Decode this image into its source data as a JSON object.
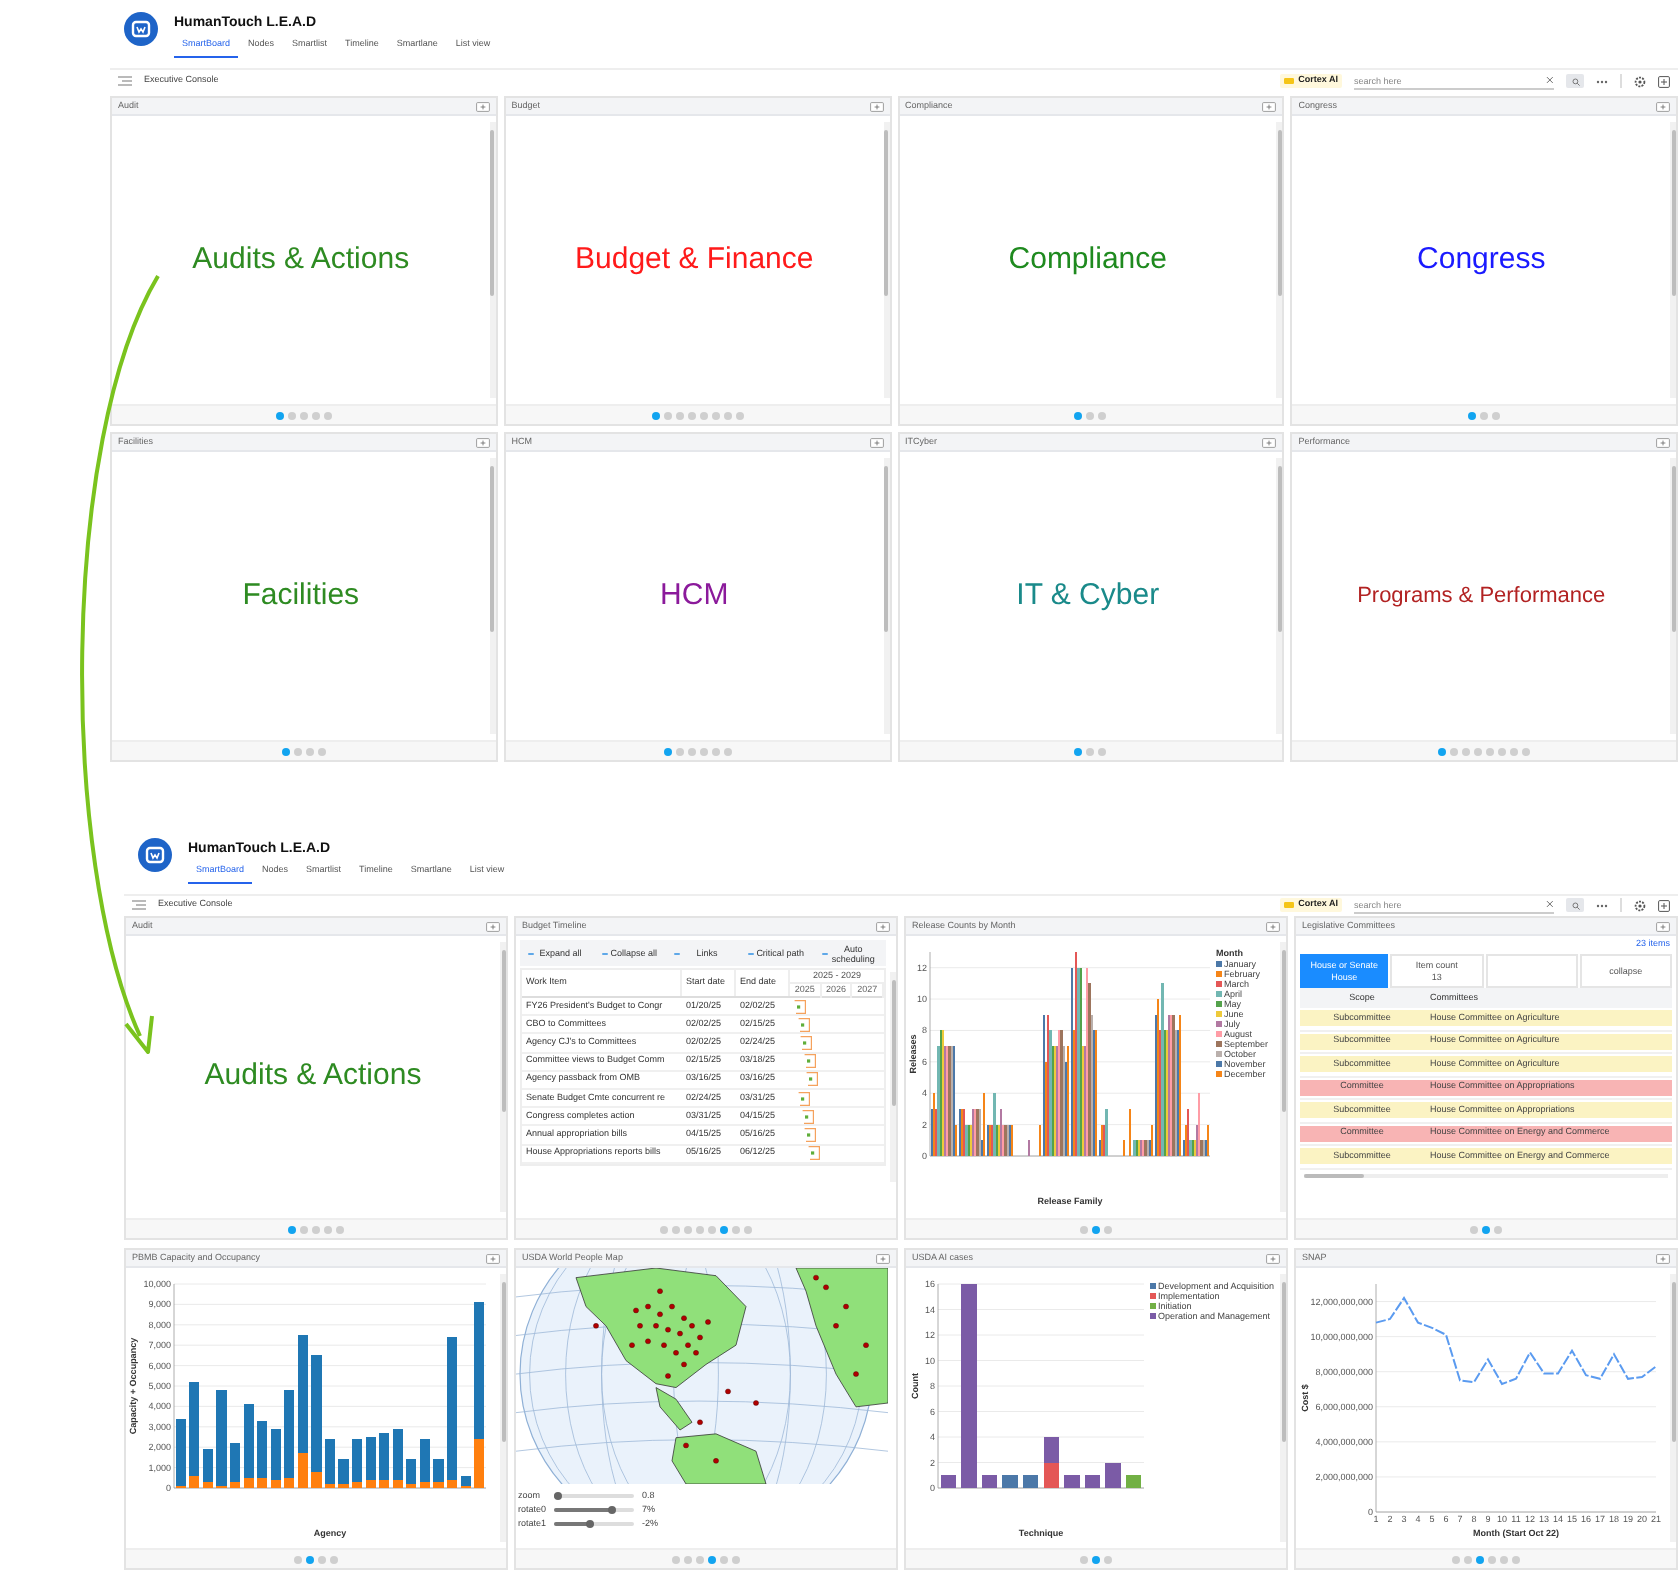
{
  "screens": [
    {
      "app_title": "HumanTouch L.E.A.D",
      "tabs": [
        {
          "label": "SmartBoard",
          "selected": true
        },
        {
          "label": "Nodes",
          "selected": false
        },
        {
          "label": "Smartlist",
          "selected": false
        },
        {
          "label": "Timeline",
          "selected": false
        },
        {
          "label": "Smartlane",
          "selected": false
        },
        {
          "label": "List view",
          "selected": false
        }
      ],
      "breadcrumb": "Executive Console",
      "ai_label": "Cortex AI",
      "search": {
        "placeholder": "search here"
      },
      "panels": [
        {
          "title": "Audit",
          "kind": "text",
          "heading": "Audits & Actions",
          "color": "#2e8b22",
          "pages": [
            {
              "selected": true
            },
            {
              "selected": false
            },
            {
              "selected": false
            },
            {
              "selected": false
            },
            {
              "selected": false
            }
          ]
        },
        {
          "title": "Budget",
          "kind": "text",
          "heading": "Budget & Finance",
          "color": "#ff1a1a",
          "pages": [
            {
              "selected": true
            },
            {
              "selected": false
            },
            {
              "selected": false
            },
            {
              "selected": false
            },
            {
              "selected": false
            },
            {
              "selected": false
            },
            {
              "selected": false
            },
            {
              "selected": false
            }
          ]
        },
        {
          "title": "Compliance",
          "kind": "text",
          "heading": "Compliance",
          "color": "#1f8a1f",
          "pages": [
            {
              "selected": true
            },
            {
              "selected": false
            },
            {
              "selected": false
            }
          ]
        },
        {
          "title": "Congress",
          "kind": "text",
          "heading": "Congress",
          "color": "#1a1aff",
          "pages": [
            {
              "selected": true
            },
            {
              "selected": false
            },
            {
              "selected": false
            }
          ]
        },
        {
          "title": "Facilities",
          "kind": "text",
          "heading": "Facilities",
          "color": "#2e8b22",
          "pages": [
            {
              "selected": true
            },
            {
              "selected": false
            },
            {
              "selected": false
            },
            {
              "selected": false
            }
          ]
        },
        {
          "title": "HCM",
          "kind": "text",
          "heading": "HCM",
          "color": "#8b1a9b",
          "pages": [
            {
              "selected": true
            },
            {
              "selected": false
            },
            {
              "selected": false
            },
            {
              "selected": false
            },
            {
              "selected": false
            },
            {
              "selected": false
            }
          ]
        },
        {
          "title": "ITCyber",
          "kind": "text",
          "heading": "IT & Cyber",
          "color": "#1a8a8a",
          "pages": [
            {
              "selected": true
            },
            {
              "selected": false
            },
            {
              "selected": false
            }
          ]
        },
        {
          "title": "Performance",
          "kind": "text",
          "heading": "Programs & Performance",
          "color": "#b22222",
          "pages": [
            {
              "selected": true
            },
            {
              "selected": false
            },
            {
              "selected": false
            },
            {
              "selected": false
            },
            {
              "selected": false
            },
            {
              "selected": false
            },
            {
              "selected": false
            },
            {
              "selected": false
            }
          ]
        }
      ]
    },
    {
      "app_title": "HumanTouch L.E.A.D",
      "tabs": [
        {
          "label": "SmartBoard",
          "selected": true
        },
        {
          "label": "Nodes",
          "selected": false
        },
        {
          "label": "Smartlist",
          "selected": false
        },
        {
          "label": "Timeline",
          "selected": false
        },
        {
          "label": "Smartlane",
          "selected": false
        },
        {
          "label": "List view",
          "selected": false
        }
      ],
      "breadcrumb": "Executive Console",
      "ai_label": "Cortex AI",
      "search": {
        "placeholder": "search here"
      },
      "panels": [
        {
          "title": "Audit",
          "kind": "text",
          "heading": "Audits & Actions",
          "color": "#2e8b22",
          "pages": [
            {
              "selected": true
            },
            {
              "selected": false
            },
            {
              "selected": false
            },
            {
              "selected": false
            },
            {
              "selected": false
            }
          ]
        },
        {
          "title": "Budget Timeline",
          "kind": "timeline",
          "toolbar": [
            "Expand all",
            "Collapse all",
            "Links",
            "Critical path",
            "Auto scheduling"
          ],
          "columns": [
            "Work Item",
            "Start date",
            "End date"
          ],
          "range": "2025 - 2029",
          "years": [
            "2025",
            "2026",
            "2027"
          ],
          "rows": [
            {
              "work_item": "FY26 President's Budget to Congr",
              "start": "01/20/25",
              "end": "02/02/25"
            },
            {
              "work_item": "CBO to Committees",
              "start": "02/02/25",
              "end": "02/15/25"
            },
            {
              "work_item": "Agency CJ's to Committees",
              "start": "02/02/25",
              "end": "02/24/25"
            },
            {
              "work_item": "Committee views to Budget Comm",
              "start": "02/15/25",
              "end": "03/18/25"
            },
            {
              "work_item": "Agency passback from OMB",
              "start": "03/16/25",
              "end": "03/16/25"
            },
            {
              "work_item": "Senate Budget Cmte concurrent re",
              "start": "02/24/25",
              "end": "03/31/25"
            },
            {
              "work_item": "Congress completes action",
              "start": "03/31/25",
              "end": "04/15/25"
            },
            {
              "work_item": "Annual appropriation bills",
              "start": "04/15/25",
              "end": "05/16/25"
            },
            {
              "work_item": "House Appropriations reports bills",
              "start": "05/16/25",
              "end": "06/12/25"
            }
          ],
          "pages": [
            {
              "selected": false
            },
            {
              "selected": false
            },
            {
              "selected": false
            },
            {
              "selected": false
            },
            {
              "selected": false
            },
            {
              "selected": true
            },
            {
              "selected": false
            },
            {
              "selected": false
            }
          ]
        },
        {
          "title": "Release Counts by Month",
          "kind": "chart",
          "legend_title": "Month",
          "chart_data": {
            "type": "bar",
            "grid": true,
            "legend": "right",
            "ylabel": "Releases",
            "xlabel": "Release Family",
            "yticks": [
              0,
              2,
              4,
              6,
              8,
              10,
              12
            ],
            "ylim": [
              0,
              13
            ],
            "series": [
              {
                "name": "January",
                "color": "#4c78a8",
                "values": [
                  3,
                  3,
                  2,
                  0,
                  9,
                  12,
                  1,
                  0,
                  9,
                  1
                ]
              },
              {
                "name": "February",
                "color": "#f58518",
                "values": [
                  4,
                  3,
                  2,
                  0,
                  6,
                  8,
                  2,
                  3,
                  10,
                  2
                ]
              },
              {
                "name": "March",
                "color": "#e45756",
                "values": [
                  3,
                  3,
                  2,
                  0,
                  9,
                  13,
                  2,
                  0,
                  8,
                  3
                ]
              },
              {
                "name": "April",
                "color": "#72b7b2",
                "values": [
                  7,
                  2,
                  4,
                  0,
                  8,
                  12,
                  3,
                  1,
                  11,
                  1
                ]
              },
              {
                "name": "May",
                "color": "#54a24b",
                "values": [
                  8,
                  2,
                  2,
                  0,
                  7,
                  12,
                  0,
                  1,
                  8,
                  1
                ]
              },
              {
                "name": "June",
                "color": "#eeca3b",
                "values": [
                  8,
                  2,
                  2,
                  0,
                  7,
                  7,
                  0,
                  1,
                  8,
                  1
                ]
              },
              {
                "name": "July",
                "color": "#b279a2",
                "values": [
                  7,
                  3,
                  3,
                  1,
                  7,
                  7,
                  0,
                  1,
                  9,
                  2
                ]
              },
              {
                "name": "August",
                "color": "#ff9da6",
                "values": [
                  7,
                  3,
                  2,
                  0,
                  8,
                  12,
                  0,
                  1,
                  9,
                  4
                ]
              },
              {
                "name": "September",
                "color": "#9d755d",
                "values": [
                  7,
                  3,
                  2,
                  0,
                  8,
                  11,
                  0,
                  1,
                  9,
                  1
                ]
              },
              {
                "name": "October",
                "color": "#bab0ac",
                "values": [
                  7,
                  3,
                  2,
                  0,
                  7,
                  9,
                  0,
                  1,
                  8,
                  1
                ]
              },
              {
                "name": "November",
                "color": "#4c78a8",
                "values": [
                  7,
                  1,
                  2,
                  0,
                  6,
                  8,
                  0,
                  1,
                  8,
                  1
                ]
              },
              {
                "name": "December",
                "color": "#f58518",
                "values": [
                  2,
                  4,
                  2,
                  2,
                  7,
                  8,
                  1,
                  2,
                  9,
                  2
                ]
              }
            ]
          },
          "pages": [
            {
              "selected": false
            },
            {
              "selected": true
            },
            {
              "selected": false
            }
          ]
        },
        {
          "title": "Legislative Committees",
          "kind": "committees",
          "count_link": "23 items",
          "cards": [
            {
              "label": "House or Senate",
              "value": "House",
              "selected": true
            },
            {
              "label": "Item count",
              "value": "13",
              "selected": false
            },
            {
              "selected": false
            },
            {
              "label": "collapse",
              "selected": false
            }
          ],
          "columns": [
            "Scope",
            "Committees"
          ],
          "rows": [
            {
              "scope": "Subcommittee",
              "committee": "House Committee on Agriculture",
              "color": "#fbf3c3"
            },
            {
              "scope": "Subcommittee",
              "committee": "House Committee on Agriculture",
              "color": "#fbf3c3"
            },
            {
              "scope": "Subcommittee",
              "committee": "House Committee on Agriculture",
              "color": "#fbf3c3"
            },
            {
              "scope": "Committee",
              "committee": "House Committee on Appropriations",
              "color": "#f8b4b4"
            },
            {
              "scope": "Subcommittee",
              "committee": "House Committee on Appropriations",
              "color": "#fbf3c3"
            },
            {
              "scope": "Committee",
              "committee": "House Committee on Energy and Commerce",
              "color": "#f8b4b4"
            },
            {
              "scope": "Subcommittee",
              "committee": "House Committee on Energy and Commerce",
              "color": "#fbf3c3"
            }
          ],
          "pages": [
            {
              "selected": false
            },
            {
              "selected": true
            },
            {
              "selected": false
            }
          ]
        },
        {
          "title": "PBMB Capacity and Occupancy",
          "kind": "chart",
          "chart_data": {
            "type": "bar",
            "stacked": true,
            "grid": true,
            "ylabel": "Capacity + Occupancy",
            "xlabel": "Agency",
            "ylim": [
              0,
              10000
            ],
            "yticks": [
              0,
              {
                "value": 1000,
                "label": "1,000"
              },
              {
                "value": 2000,
                "label": "2,000"
              },
              {
                "value": 3000,
                "label": "3,000"
              },
              {
                "value": 4000,
                "label": "4,000"
              },
              {
                "value": 5000,
                "label": "5,000"
              },
              {
                "value": 6000,
                "label": "6,000"
              },
              {
                "value": 7000,
                "label": "7,000"
              },
              {
                "value": 8000,
                "label": "8,000"
              },
              {
                "value": 9000,
                "label": "9,000"
              },
              {
                "value": 10000,
                "label": "10,000"
              }
            ],
            "series": [
              {
                "color": "#ff7f0e",
                "values": [
                  100,
                  600,
                  300,
                  100,
                  300,
                  500,
                  500,
                  400,
                  500,
                  1700,
                  800,
                  200,
                  200,
                  300,
                  400,
                  400,
                  400,
                  200,
                  300,
                  300,
                  400,
                  100,
                  2400
                ]
              },
              {
                "color": "#1f77b4",
                "values": [
                  3300,
                  4600,
                  1600,
                  4700,
                  1900,
                  3600,
                  2800,
                  2500,
                  4300,
                  5800,
                  5700,
                  2200,
                  1200,
                  2100,
                  2100,
                  2300,
                  2500,
                  1200,
                  2100,
                  1100,
                  7000,
                  500,
                  6700
                ]
              }
            ]
          },
          "pages": [
            {
              "selected": false
            },
            {
              "selected": true
            },
            {
              "selected": false
            },
            {
              "selected": false
            }
          ]
        },
        {
          "title": "USDA World People Map",
          "kind": "map",
          "sliders": [
            {
              "label": "zoom",
              "level": 0.05,
              "reading": "0.8"
            },
            {
              "label": "rotate0",
              "level": 0.72,
              "reading": "7%"
            },
            {
              "label": "rotate1",
              "level": 0.45,
              "reading": "-2%"
            }
          ],
          "pages": [
            {
              "selected": false
            },
            {
              "selected": false
            },
            {
              "selected": false
            },
            {
              "selected": true
            },
            {
              "selected": false
            },
            {
              "selected": false
            }
          ]
        },
        {
          "title": "USDA AI cases",
          "kind": "chart",
          "chart_data": {
            "type": "bar",
            "stacked": true,
            "grid": true,
            "legend": "right",
            "ylabel": "Count",
            "xlabel": "Technique",
            "yticks": [
              0,
              2,
              4,
              6,
              8,
              10,
              12,
              14,
              16
            ],
            "ylim": [
              0,
              16
            ],
            "series": [
              {
                "name": "Development and Acquisition",
                "color": "#4c78a8",
                "values": [
                  0,
                  0,
                  0,
                  1,
                  1,
                  0,
                  0,
                  0,
                  0,
                  0
                ]
              },
              {
                "name": "Implementation",
                "color": "#e45756",
                "values": [
                  0,
                  0,
                  0,
                  0,
                  0,
                  2,
                  0,
                  0,
                  0,
                  0
                ]
              },
              {
                "name": "Initiation",
                "color": "#72b045",
                "values": [
                  0,
                  0,
                  0,
                  0,
                  0,
                  0,
                  0,
                  0,
                  0,
                  1
                ]
              },
              {
                "name": "Operation and Management",
                "color": "#7b5ba6",
                "values": [
                  1,
                  16,
                  1,
                  0,
                  0,
                  2,
                  1,
                  1,
                  2,
                  0
                ]
              }
            ]
          },
          "pages": [
            {
              "selected": false
            },
            {
              "selected": true
            },
            {
              "selected": false
            }
          ]
        },
        {
          "title": "SNAP",
          "kind": "chart",
          "chart_data": {
            "type": "line",
            "grid": true,
            "ylabel": "Cost $",
            "xlabel": "Month (Start Oct 22)",
            "ylim": [
              0,
              13000000000
            ],
            "xlim": [
              1,
              21
            ],
            "yticks": [
              0,
              {
                "value": 2000000000,
                "label": "2,000,000,000"
              },
              {
                "value": 4000000000,
                "label": "4,000,000,000"
              },
              {
                "value": 6000000000,
                "label": "6,000,000,000"
              },
              {
                "value": 8000000000,
                "label": "8,000,000,000"
              },
              {
                "value": 10000000000,
                "label": "10,000,000,000"
              },
              {
                "value": 12000000000,
                "label": "12,000,000,000"
              }
            ],
            "x": [
              1,
              2,
              3,
              4,
              5,
              6,
              7,
              8,
              9,
              10,
              11,
              12,
              13,
              14,
              15,
              16,
              17,
              18,
              19,
              20,
              21
            ],
            "xticks": [
              1,
              2,
              3,
              4,
              5,
              6,
              7,
              8,
              9,
              10,
              11,
              12,
              13,
              14,
              15,
              16,
              17,
              18,
              19,
              20,
              21
            ],
            "series": [
              {
                "color": "#5b9bf0",
                "line_style": "dashed",
                "values": [
                  10800000000,
                  11000000000,
                  12200000000,
                  10800000000,
                  10500000000,
                  10100000000,
                  7500000000,
                  7400000000,
                  8700000000,
                  7300000000,
                  7600000000,
                  9100000000,
                  7900000000,
                  7900000000,
                  9200000000,
                  7800000000,
                  7600000000,
                  9000000000,
                  7600000000,
                  7700000000,
                  8300000000
                ]
              }
            ]
          },
          "pages": [
            {
              "selected": false
            },
            {
              "selected": false
            },
            {
              "selected": true
            },
            {
              "selected": false
            },
            {
              "selected": false
            },
            {
              "selected": false
            }
          ]
        }
      ]
    }
  ]
}
